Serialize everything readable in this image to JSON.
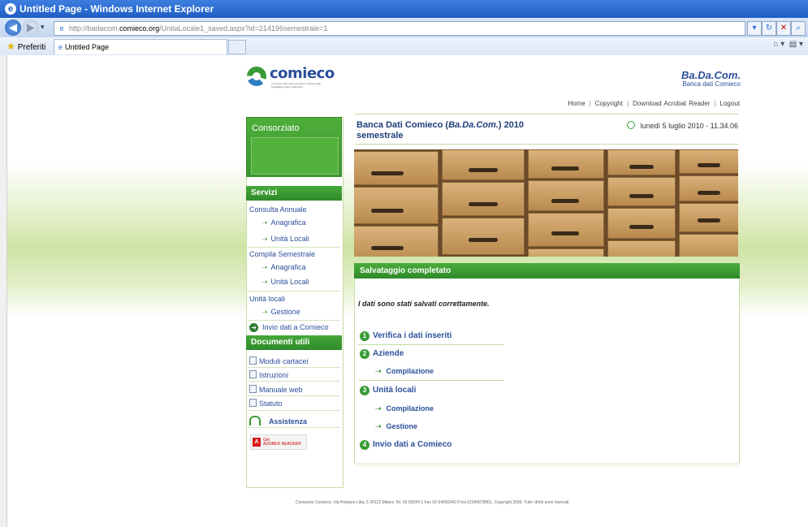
{
  "browser": {
    "window_title": "Untitled Page - Windows Internet Explorer",
    "url_prefix": "http://badacom.",
    "url_host": "comieco.org",
    "url_path": "/UnitaLocale1_saved.aspx?id=214196semestrale=1",
    "favorites_label": "Preferiti",
    "tab_title": "Untitled Page"
  },
  "header": {
    "logo_text": "comieco",
    "logo_tagline": "Consorzio Nazionale Recupero e Riciclo degli Imballaggi a base Cellulosica",
    "brand": "Ba.Da.Com.",
    "brand_sub": "Banca dati Comieco",
    "nav": [
      "Home",
      "Copyright",
      "Download Acrobat Reader",
      "Logout"
    ]
  },
  "sidebar": {
    "consorziato_label": "Consorziato",
    "servizi_label": "Servizi",
    "consulta_annuale": "Consulta Annuale",
    "consulta_anagrafica": "Anagrafica",
    "consulta_unita": "Unità Locali",
    "compila_semestrale": "Compila Semestrale",
    "compila_anagrafica": "Anagrafica",
    "compila_unita": "Unità Locali",
    "unita_locali": "Unità locali",
    "gestione": "Gestione",
    "invio": "Invio dati a Comieco",
    "documenti_label": "Documenti utili",
    "docs": [
      "Moduli cartacei",
      "Istruzioni",
      "Manuale web",
      "Statuto"
    ],
    "assistenza": "Assistenza",
    "adobe_get": "Get",
    "adobe_reader": "ADOBE® READER®"
  },
  "main": {
    "title_prefix": "Banca Dati Comieco (",
    "title_italic": "Ba.Da.Com.",
    "title_suffix": ") 2010",
    "title_line2": "semestrale",
    "date": "lunedì 5 luglio 2010 - 11.34.06",
    "panel_title": "Salvataggio completato",
    "message": "I dati sono stati salvati correttamente.",
    "step1": "Verifica i dati inseriti",
    "step2": "Aziende",
    "step2_sub": "Compilazione",
    "step3": "Unità locali",
    "step3_sub1": "Compilazione",
    "step3_sub2": "Gestione",
    "step4": "Invio dati a Comieco",
    "step_numbers": [
      "1",
      "2",
      "3",
      "4"
    ]
  },
  "footer": {
    "text": "Consorzio Comieco, Via Pompeo Litta, 5 20122 Milano Tel. 02-55024.1 Fax 02-54050240 P.Iva:12345678901. Copyright 2009. Tutti i diritti sono riservati."
  },
  "colors": {
    "brand_green": "#3a9b36",
    "brand_blue": "#2b4f9a",
    "title_blue": "#1f3e7a"
  }
}
